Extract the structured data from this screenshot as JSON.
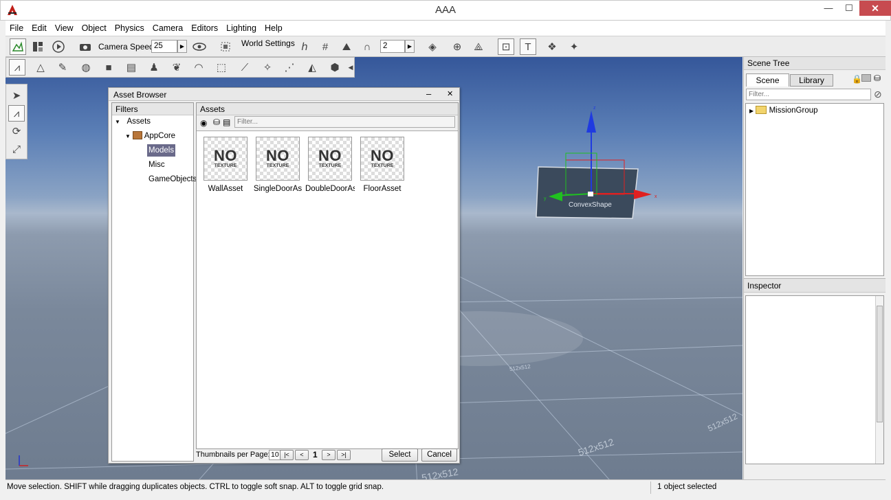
{
  "window": {
    "title": "AAA",
    "minimize": "—",
    "maximize": "☐",
    "close": "✕"
  },
  "menu": [
    "File",
    "Edit",
    "View",
    "Object",
    "Physics",
    "Camera",
    "Editors",
    "Lighting",
    "Help"
  ],
  "toolbar": {
    "camera_speed_label": "Camera Speed",
    "camera_speed_value": "25",
    "world_settings_label": "World Settings",
    "snap_value": "2"
  },
  "viewport": {
    "object_label": "ConvexShape",
    "grid_labels": [
      "512x512",
      "512x512",
      "512x512",
      "512x512"
    ],
    "axis_x": "x",
    "axis_y": "y",
    "axis_z": "z"
  },
  "asset_browser": {
    "title": "Asset Browser",
    "minimize": "–",
    "close": "✕",
    "filters_header": "Filters",
    "assets_header": "Assets",
    "filter_placeholder": "Filter...",
    "tree": [
      {
        "label": "Assets",
        "expanded": true
      },
      {
        "label": "AppCore",
        "expanded": true
      },
      {
        "label": "Models",
        "selected": true
      },
      {
        "label": "Misc"
      },
      {
        "label": "GameObjects"
      }
    ],
    "thumbnails": [
      {
        "label": "WallAsset",
        "no": "NO",
        "texture": "TEXTURE"
      },
      {
        "label": "SingleDoorAs",
        "no": "NO",
        "texture": "TEXTURE"
      },
      {
        "label": "DoubleDoorAs",
        "no": "NO",
        "texture": "TEXTURE"
      },
      {
        "label": "FloorAsset",
        "no": "NO",
        "texture": "TEXTURE"
      }
    ],
    "thumbnails_per_page_label": "Thumbnails per Page:",
    "thumbnails_per_page": "10",
    "first_page": "|<",
    "prev_page": "<",
    "current_page": "1",
    "next_page": ">",
    "last_page": ">|",
    "select_button": "Select",
    "cancel_button": "Cancel"
  },
  "scene_tree": {
    "header": "Scene Tree",
    "tab_scene": "Scene",
    "tab_library": "Library",
    "filter_placeholder": "Filter...",
    "root_item": "MissionGroup"
  },
  "inspector": {
    "header": "Inspector"
  },
  "status": {
    "hint": "Move selection.  SHIFT while dragging duplicates objects.  CTRL to toggle soft snap.  ALT to toggle grid snap.",
    "selection": "1 object selected"
  },
  "colors": {
    "accent_selected": "#6a6a8a",
    "axis_x": "#e02020",
    "axis_y": "#20c020",
    "axis_z": "#1f3ae0"
  }
}
